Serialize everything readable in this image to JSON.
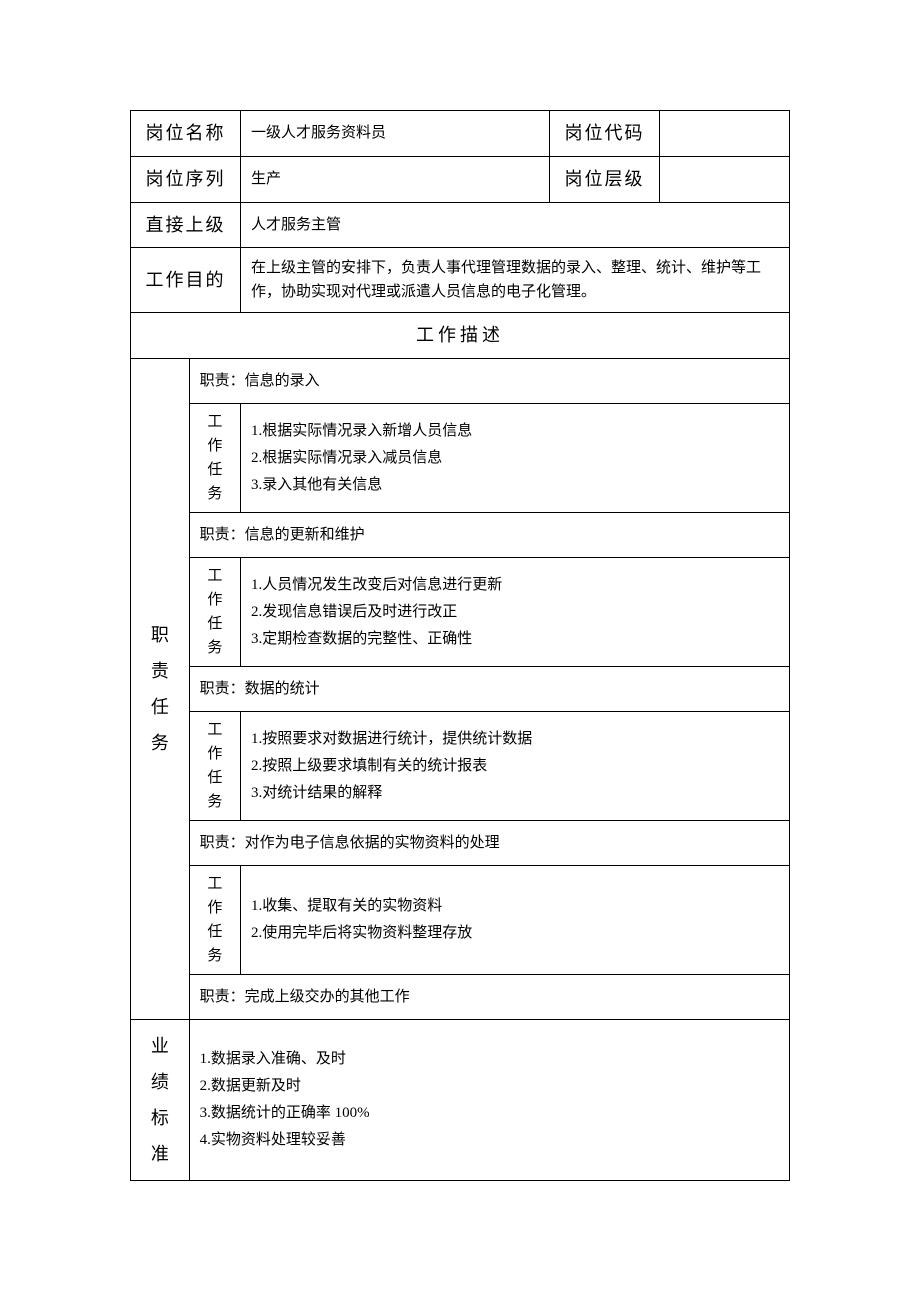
{
  "header": {
    "position_name_label": "岗位名称",
    "position_name_value": "一级人才服务资料员",
    "position_code_label": "岗位代码",
    "position_code_value": "",
    "position_series_label": "岗位序列",
    "position_series_value": "生产",
    "position_level_label": "岗位层级",
    "position_level_value": "",
    "direct_superior_label": "直接上级",
    "direct_superior_value": "人才服务主管",
    "work_purpose_label": "工作目的",
    "work_purpose_value": "在上级主管的安排下，负责人事代理管理数据的录入、整理、统计、维护等工作，协助实现对代理或派遣人员信息的电子化管理。"
  },
  "section_title": "工作描述",
  "responsibility_label": "职\n责\n任\n务",
  "task_label": "工\n作\n任\n务",
  "duty_prefix": "职责：",
  "duties": [
    {
      "title": "信息的录入",
      "tasks": "1.根据实际情况录入新增人员信息\n2.根据实际情况录入减员信息\n3.录入其他有关信息"
    },
    {
      "title": "信息的更新和维护",
      "tasks": "1.人员情况发生改变后对信息进行更新\n2.发现信息错误后及时进行改正\n3.定期检查数据的完整性、正确性"
    },
    {
      "title": "数据的统计",
      "tasks": "1.按照要求对数据进行统计，提供统计数据\n2.按照上级要求填制有关的统计报表\n3.对统计结果的解释"
    },
    {
      "title": "对作为电子信息依据的实物资料的处理",
      "tasks": "1.收集、提取有关的实物资料\n2.使用完毕后将实物资料整理存放"
    },
    {
      "title": "完成上级交办的其他工作",
      "tasks": null
    }
  ],
  "performance": {
    "label": "业\n绩\n标\n准",
    "content": "1.数据录入准确、及时\n2.数据更新及时\n3.数据统计的正确率 100%\n4.实物资料处理较妥善"
  }
}
